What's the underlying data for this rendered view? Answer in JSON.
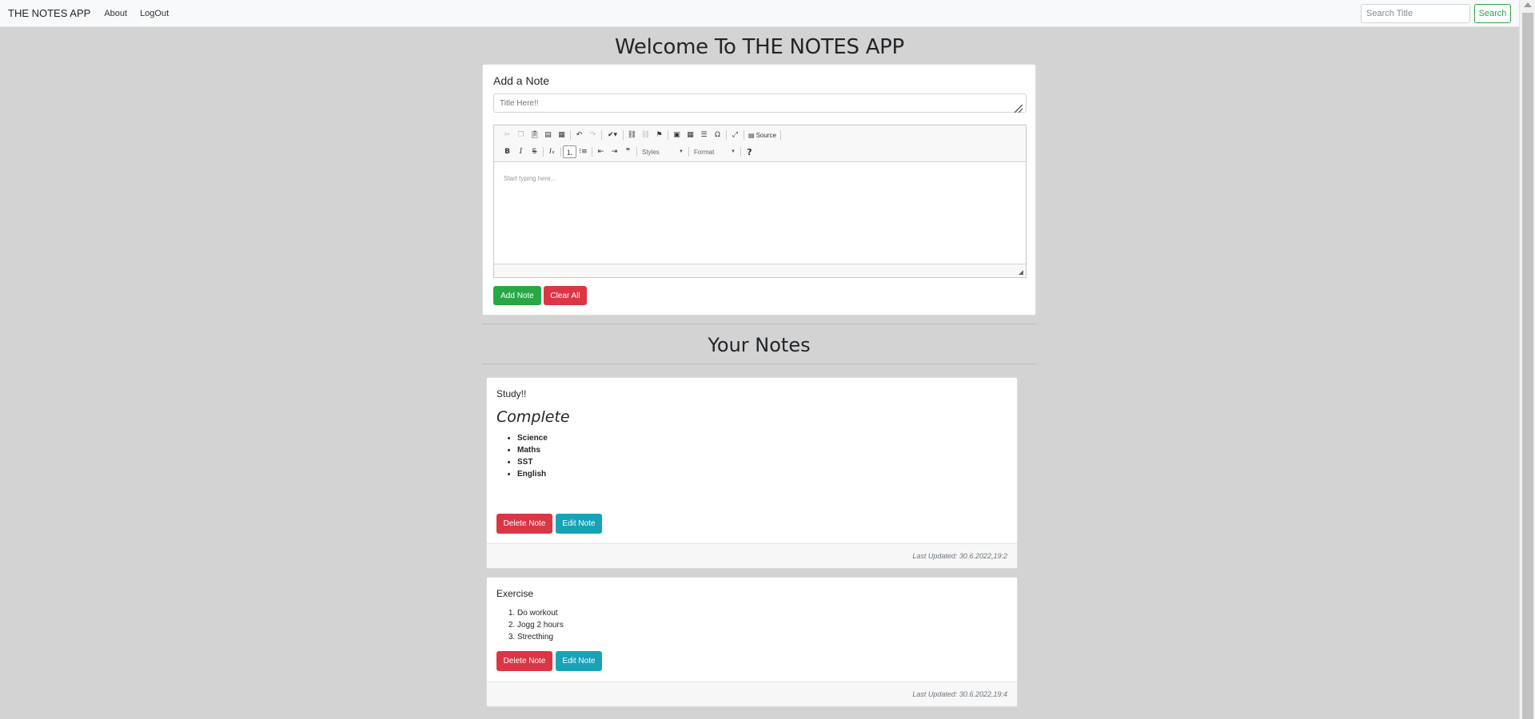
{
  "navbar": {
    "brand": "THE NOTES APP",
    "links": [
      "About",
      "LogOut"
    ],
    "search_placeholder": "Search Title",
    "search_button": "Search"
  },
  "heading": "Welcome To THE NOTES APP",
  "add_note": {
    "title": "Add a Note",
    "title_placeholder": "Title Here!!",
    "editor_placeholder": "Start typing here...",
    "toolbar": {
      "source_label": "Source",
      "styles_label": "Styles",
      "format_label": "Format",
      "help_label": "?"
    },
    "add_button": "Add Note",
    "clear_button": "Clear All"
  },
  "your_notes_heading": "Your Notes",
  "notes": [
    {
      "title": "Study!!",
      "heading": "Complete",
      "items": [
        "Science",
        "Maths",
        "SST",
        "English"
      ],
      "list_type": "bullet",
      "delete_label": "Delete Note",
      "edit_label": "Edit Note",
      "last_updated": "Last Updated: 30.6.2022,19:2"
    },
    {
      "title": "Exercise",
      "items": [
        "Do workout",
        "Jogg 2 hours",
        "Strecthing"
      ],
      "list_type": "numbered",
      "delete_label": "Delete Note",
      "edit_label": "Edit Note",
      "last_updated": "Last Updated: 30.6.2022,19:4"
    }
  ],
  "colors": {
    "success": "#28a745",
    "danger": "#dc3545",
    "info": "#17a2b8",
    "page_bg": "#d3d3d3"
  }
}
